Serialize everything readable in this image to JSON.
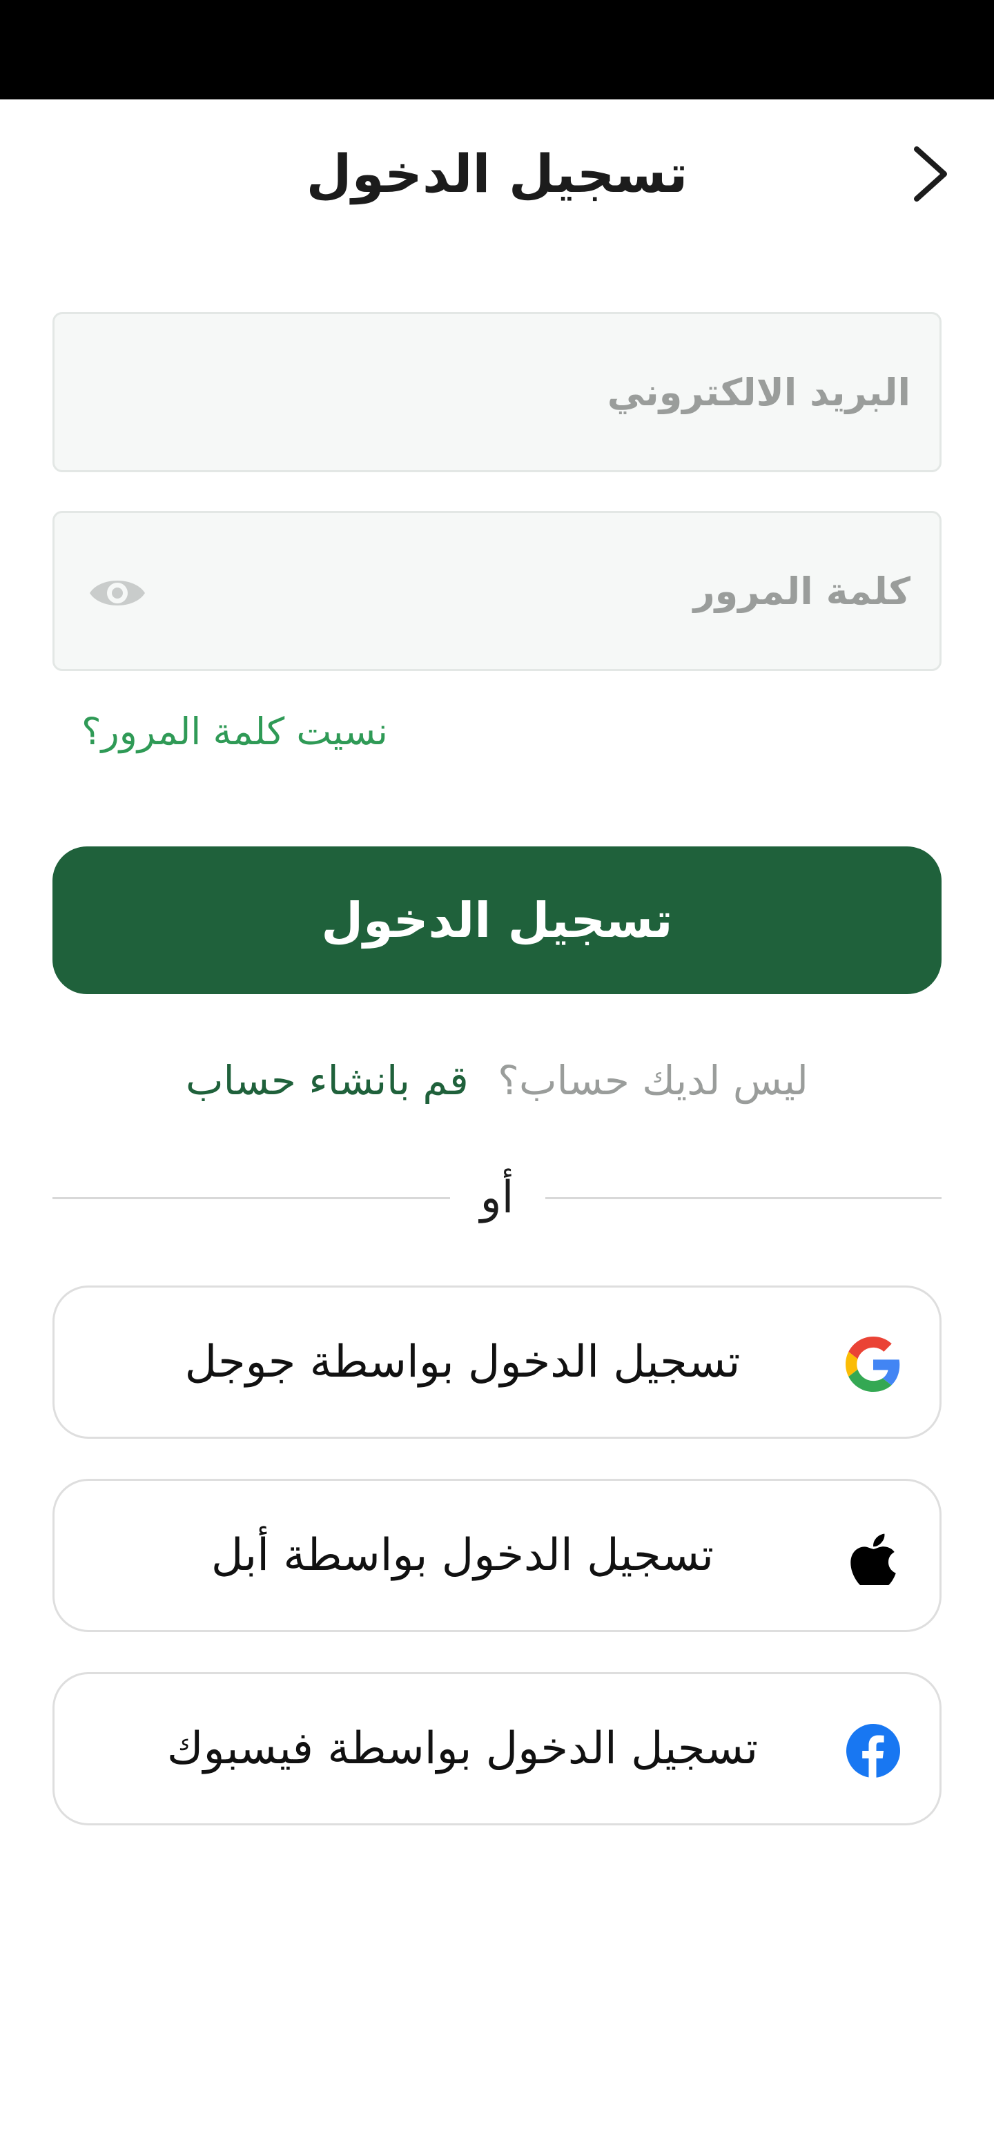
{
  "header": {
    "title": "تسجيل الدخول",
    "back_icon": "chevron-right-icon"
  },
  "form": {
    "email_placeholder": "البريد الالكتروني",
    "email_value": "",
    "password_placeholder": "كلمة المرور",
    "password_value": "",
    "password_toggle_icon": "eye-icon",
    "forgot_password": "نسيت كلمة المرور؟",
    "login_button": "تسجيل الدخول"
  },
  "signup": {
    "prompt": "ليس لديك حساب؟",
    "link": "قم بانشاء حساب"
  },
  "divider": {
    "text": "أو"
  },
  "social": {
    "google": {
      "label": "تسجيل الدخول بواسطة جوجل",
      "icon": "google-icon"
    },
    "apple": {
      "label": "تسجيل الدخول بواسطة أبل",
      "icon": "apple-icon"
    },
    "facebook": {
      "label": "تسجيل الدخول بواسطة فيسبوك",
      "icon": "facebook-icon"
    }
  },
  "colors": {
    "primary": "#1f613b",
    "link_green": "#2f9a56",
    "field_bg": "#f6f8f7",
    "muted_text": "#9a9d9b",
    "facebook_blue": "#1877f2"
  }
}
